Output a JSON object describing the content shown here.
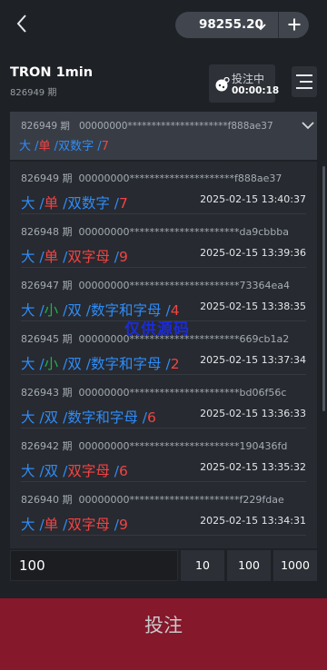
{
  "header": {
    "balance": "98255.20"
  },
  "game": {
    "title": "TRON 1min",
    "period": "826949 期",
    "bet_status_label": "投注中",
    "countdown": "00:00:18"
  },
  "latest": {
    "period": "826949 期",
    "hash": "00000000*********************f888ae37",
    "result": [
      {
        "text": "大",
        "color": "blue"
      },
      {
        "text": " /",
        "color": "blue"
      },
      {
        "text": "单",
        "color": "red"
      },
      {
        "text": " /",
        "color": "blue"
      },
      {
        "text": "双数字",
        "color": "blue"
      },
      {
        "text": " /",
        "color": "blue"
      },
      {
        "text": "7",
        "color": "red"
      }
    ]
  },
  "history": [
    {
      "period": "826949 期",
      "hash": "00000000*********************f888ae37",
      "time": "2025-02-15 13:40:37",
      "result": [
        {
          "text": "大",
          "color": "blue"
        },
        {
          "text": " /",
          "color": "blue"
        },
        {
          "text": "单",
          "color": "red"
        },
        {
          "text": " /",
          "color": "blue"
        },
        {
          "text": "双数字",
          "color": "blue"
        },
        {
          "text": " /",
          "color": "blue"
        },
        {
          "text": "7",
          "color": "red"
        }
      ]
    },
    {
      "period": "826948 期",
      "hash": "00000000**********************da9cbbba",
      "time": "2025-02-15 13:39:36",
      "result": [
        {
          "text": "大",
          "color": "blue"
        },
        {
          "text": " /",
          "color": "blue"
        },
        {
          "text": "单",
          "color": "red"
        },
        {
          "text": " /",
          "color": "blue"
        },
        {
          "text": "双字母",
          "color": "red"
        },
        {
          "text": " /",
          "color": "blue"
        },
        {
          "text": "9",
          "color": "red"
        }
      ]
    },
    {
      "period": "826947 期",
      "hash": "00000000**********************73364ea4",
      "time": "2025-02-15 13:38:35",
      "result": [
        {
          "text": "大",
          "color": "blue"
        },
        {
          "text": " /",
          "color": "blue"
        },
        {
          "text": "小",
          "color": "green"
        },
        {
          "text": " /",
          "color": "blue"
        },
        {
          "text": "双",
          "color": "blue"
        },
        {
          "text": " /",
          "color": "blue"
        },
        {
          "text": "数字和字母",
          "color": "blue"
        },
        {
          "text": " /",
          "color": "blue"
        },
        {
          "text": "4",
          "color": "red"
        }
      ]
    },
    {
      "period": "826945 期",
      "hash": "00000000**********************669cb1a2",
      "time": "2025-02-15 13:37:34",
      "result": [
        {
          "text": "大",
          "color": "blue"
        },
        {
          "text": " /",
          "color": "blue"
        },
        {
          "text": "小",
          "color": "green"
        },
        {
          "text": " /",
          "color": "blue"
        },
        {
          "text": "双",
          "color": "blue"
        },
        {
          "text": " /",
          "color": "blue"
        },
        {
          "text": "数字和字母",
          "color": "blue"
        },
        {
          "text": " /",
          "color": "blue"
        },
        {
          "text": "2",
          "color": "red"
        }
      ]
    },
    {
      "period": "826943 期",
      "hash": "00000000**********************bd06f56c",
      "time": "2025-02-15 13:36:33",
      "result": [
        {
          "text": "大",
          "color": "blue"
        },
        {
          "text": " /",
          "color": "blue"
        },
        {
          "text": "双",
          "color": "blue"
        },
        {
          "text": " /",
          "color": "blue"
        },
        {
          "text": "数字和字母",
          "color": "blue"
        },
        {
          "text": " /",
          "color": "blue"
        },
        {
          "text": "6",
          "color": "red"
        }
      ]
    },
    {
      "period": "826942 期",
      "hash": "00000000**********************190436fd",
      "time": "2025-02-15 13:35:32",
      "result": [
        {
          "text": "大",
          "color": "blue"
        },
        {
          "text": " /",
          "color": "blue"
        },
        {
          "text": "双",
          "color": "blue"
        },
        {
          "text": " /",
          "color": "blue"
        },
        {
          "text": "双字母",
          "color": "red"
        },
        {
          "text": " /",
          "color": "blue"
        },
        {
          "text": "6",
          "color": "red"
        }
      ]
    },
    {
      "period": "826940 期",
      "hash": "00000000**********************f229fdae",
      "time": "2025-02-15 13:34:31",
      "result": [
        {
          "text": "大",
          "color": "blue"
        },
        {
          "text": " /",
          "color": "blue"
        },
        {
          "text": "单",
          "color": "red"
        },
        {
          "text": " /",
          "color": "blue"
        },
        {
          "text": "双字母",
          "color": "red"
        },
        {
          "text": " /",
          "color": "blue"
        },
        {
          "text": "9",
          "color": "red"
        }
      ]
    }
  ],
  "watermark": "仅供源码",
  "bet": {
    "amount": "100",
    "chips": [
      "10",
      "100",
      "1000"
    ],
    "submit_label": "投注"
  },
  "colors": {
    "blue": "#2f8cf7",
    "red": "#f34343",
    "green": "#20b24a",
    "bet_button": "#85182b"
  },
  "icons": [
    "back-arrow-icon",
    "chevron-down-icon",
    "plus-icon",
    "dice-icon",
    "menu-icon"
  ]
}
